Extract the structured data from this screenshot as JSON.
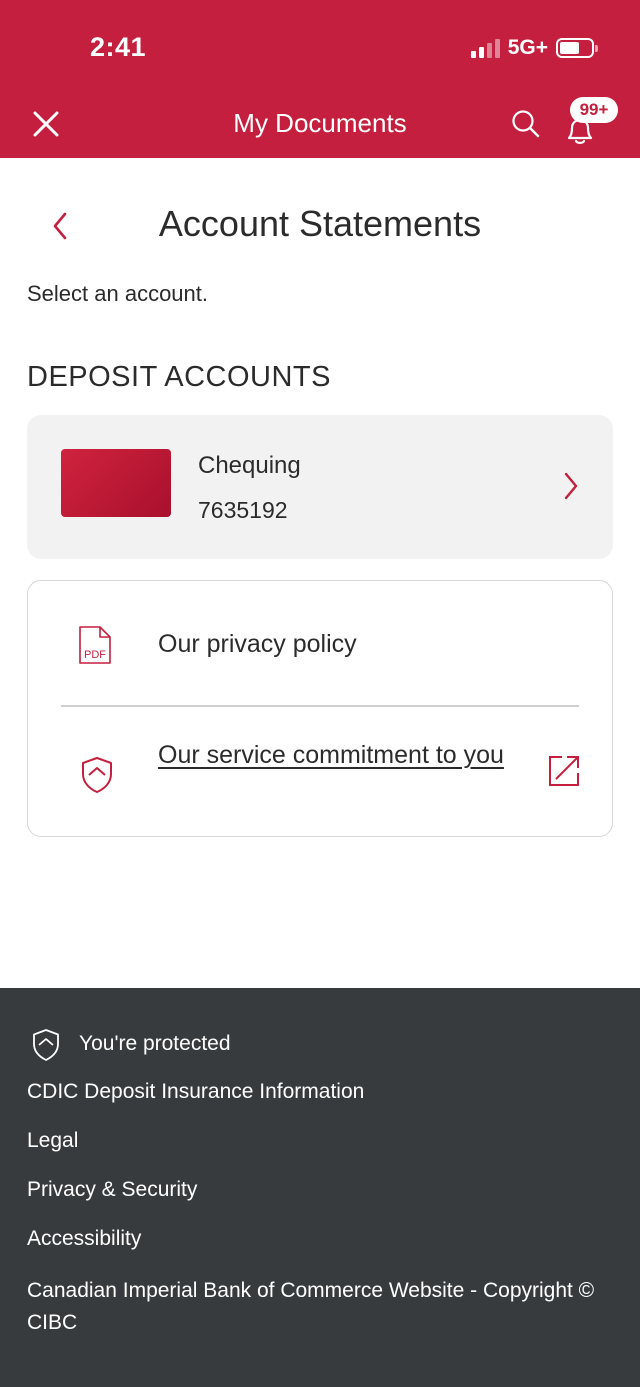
{
  "status_bar": {
    "time": "2:41",
    "network": "5G+"
  },
  "header": {
    "title": "My Documents",
    "notification_badge": "99+",
    "close_icon": "close-icon",
    "search_icon": "search-icon",
    "bell_icon": "bell-icon"
  },
  "page": {
    "title": "Account Statements",
    "subtitle": "Select an account.",
    "section_heading": "DEPOSIT ACCOUNTS"
  },
  "accounts": [
    {
      "name": "Chequing",
      "number": "7635192"
    }
  ],
  "links": {
    "privacy_policy": "Our privacy policy",
    "service_commitment": "Our service commitment to you",
    "pdf_icon_text": "PDF"
  },
  "footer": {
    "protected": "You're protected",
    "cdic": "CDIC Deposit Insurance Information",
    "legal": "Legal",
    "privacy_security": "Privacy & Security",
    "accessibility": "Accessibility",
    "copyright": "Canadian Imperial Bank of Commerce Website - Copyright © CIBC"
  },
  "colors": {
    "brand_red": "#c41f3e",
    "footer_bg": "#383b3e",
    "card_bg": "#f2f2f2"
  }
}
